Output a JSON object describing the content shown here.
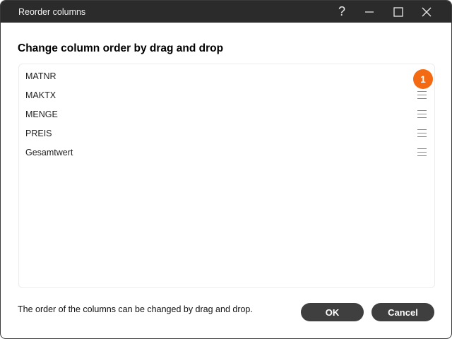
{
  "window": {
    "title": "Reorder columns",
    "controls": {
      "help": "?",
      "minimize": "minimize-icon",
      "maximize": "maximize-icon",
      "close": "close-icon"
    }
  },
  "dialog": {
    "heading": "Change column order by drag and drop",
    "columns": [
      {
        "label": "MATNR",
        "badge": "1"
      },
      {
        "label": "MAKTX"
      },
      {
        "label": "MENGE"
      },
      {
        "label": "PREIS"
      },
      {
        "label": "Gesamtwert"
      }
    ],
    "hint": "The order of the columns can be changed by drag and drop.",
    "ok_label": "OK",
    "cancel_label": "Cancel"
  },
  "colors": {
    "titlebar": "#2b2b2b",
    "badge": "#f36a12",
    "button": "#3f3f3f"
  }
}
